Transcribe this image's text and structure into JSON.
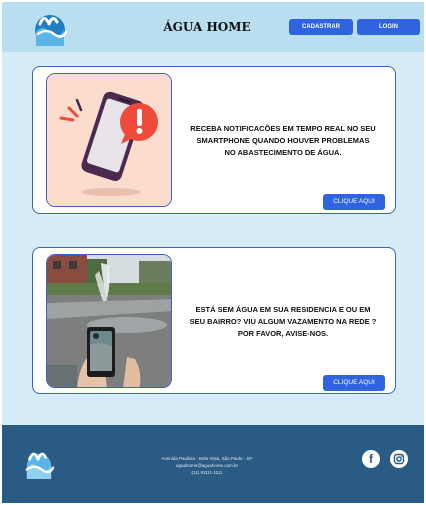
{
  "header": {
    "brand": "ÁGUA HOME",
    "register_label": "CADASTRAR",
    "login_label": "LOGIN"
  },
  "cards": [
    {
      "lines": [
        "RECEBA NOTIFICACÕES EM TEMPO REAL NO  SEU",
        "SMARTPHONE QUANDO HOUVER PROBLEMAS",
        "NO ABASTECIMENTO DE ÁGUA."
      ],
      "button_label": "CLIQUE AQUI",
      "image": "phone-alert-illustration"
    },
    {
      "lines": [
        "ESTÁ SEM ÁGUA EM SUA RESIDENCIA E OU EM",
        "SEU BAIRRO? VIU ALGUM VAZAMENTO NA REDE ?",
        "POR FAVOR, AVISE-NOS."
      ],
      "button_label": "CLIQUE AQUI",
      "image": "water-leak-street-photo"
    }
  ],
  "footer": {
    "address": "Avenida Paulista - Bela Vista, São Paulo - SP",
    "email": "aguahome@aguahome.com.br",
    "phone": "(11) 91111-1111",
    "social": [
      "facebook-icon",
      "instagram-icon"
    ]
  },
  "colors": {
    "header_bg": "#b9def0",
    "main_bg": "#d5ebf6",
    "accent": "#2f63e0",
    "footer_bg": "#2a5b84"
  }
}
